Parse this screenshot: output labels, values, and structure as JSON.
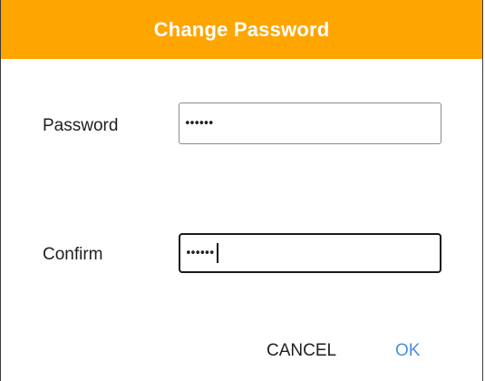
{
  "dialog": {
    "title": "Change Password",
    "accent_color": "#FFA500",
    "fields": [
      {
        "label": "Password",
        "value": "••••••",
        "type": "password",
        "focused": false
      },
      {
        "label": "Confirm",
        "value": "••••••",
        "type": "password",
        "focused": true
      }
    ],
    "buttons": {
      "cancel_label": "CANCEL",
      "cancel_color": "#1f1f1f",
      "ok_label": "OK",
      "ok_color": "#4A90E2"
    }
  }
}
